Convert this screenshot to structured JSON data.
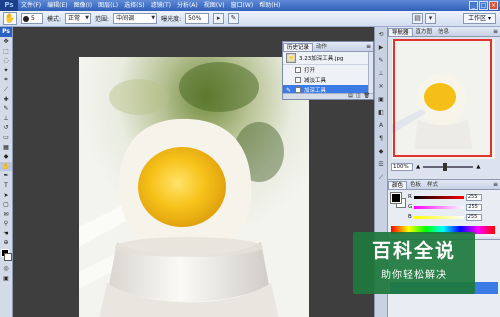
{
  "app": {
    "logo": "Ps",
    "menu": [
      "文件(F)",
      "编辑(E)",
      "图像(I)",
      "图层(L)",
      "选择(S)",
      "滤镜(T)",
      "分析(A)",
      "视图(V)",
      "窗口(W)",
      "帮助(H)"
    ]
  },
  "options": {
    "brush_size": "5",
    "mode_label": "模式:",
    "mode_value": "正常",
    "range_label": "范围:",
    "range_value": "中间调",
    "exposure_label": "曝光度:",
    "exposure_value": "50%",
    "workspace": "工作区"
  },
  "history": {
    "tabs": [
      "历史记录",
      "动作"
    ],
    "snapshot": "3.23加深工具.jpg",
    "steps": [
      "打开",
      "减淡工具",
      "加深工具"
    ],
    "selected_index": 2
  },
  "navigator": {
    "tabs": [
      "导航器",
      "直方图",
      "信息"
    ],
    "zoom": "100%"
  },
  "color": {
    "tabs": [
      "颜色",
      "色板",
      "样式"
    ],
    "channels": [
      {
        "label": "R",
        "value": "255"
      },
      {
        "label": "G",
        "value": "255"
      },
      {
        "label": "B",
        "value": "255"
      }
    ]
  },
  "watermark": {
    "title": "百科全说",
    "subtitle": "助你轻松解决"
  },
  "colors": {
    "accent": "#3a7be6",
    "menubar": "#2f5fb8",
    "watermark": "#1e783c"
  }
}
